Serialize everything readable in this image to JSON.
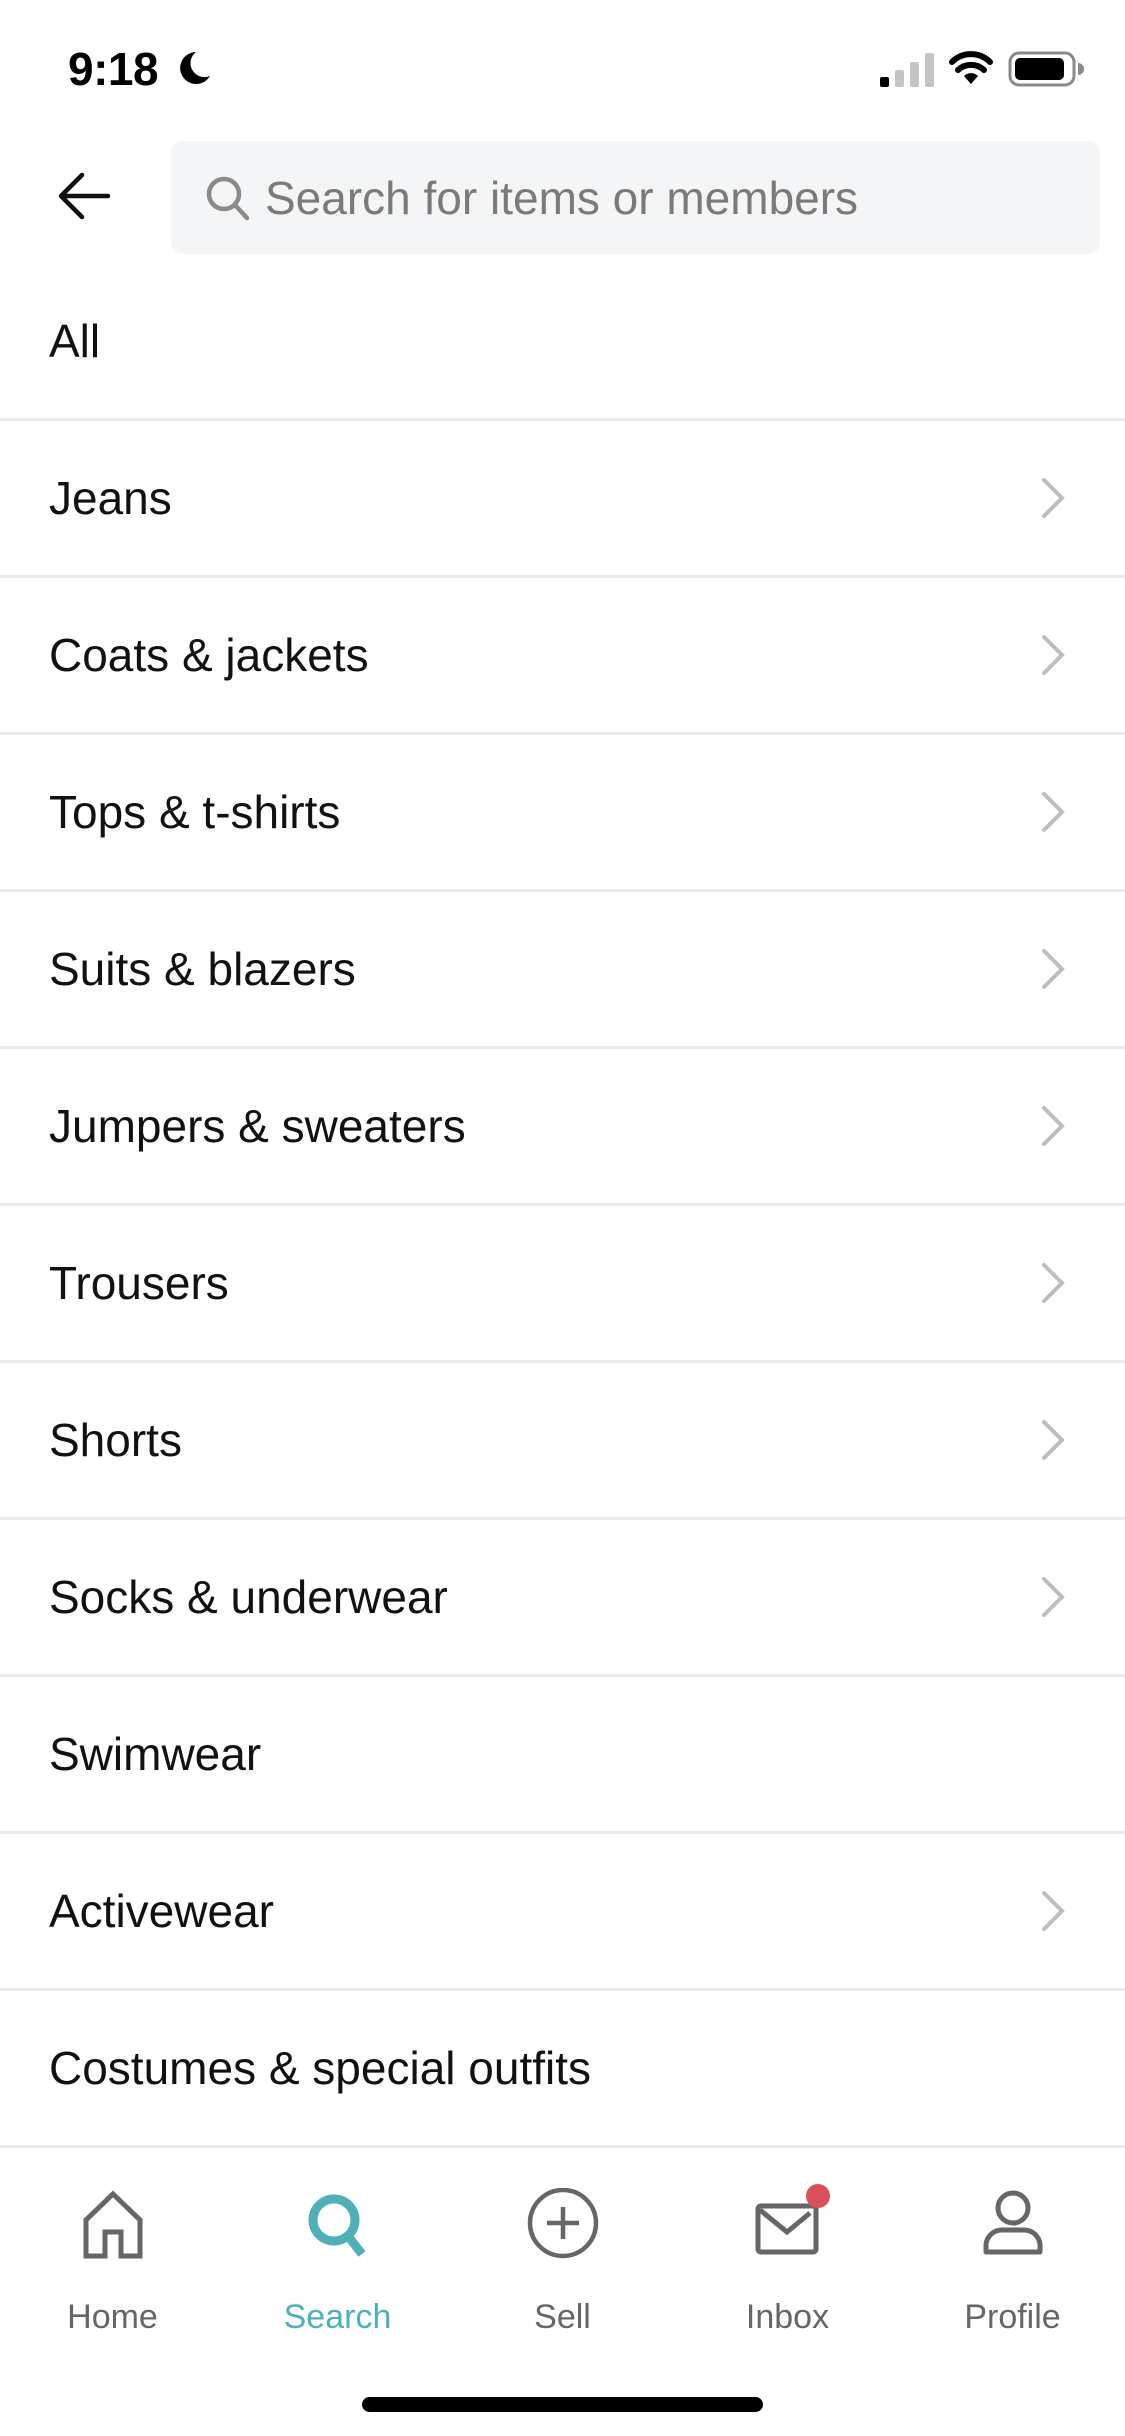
{
  "status_bar": {
    "time": "9:18",
    "focus_icon": "moon-icon",
    "signal_bars_active": 1,
    "signal_bars_total": 4,
    "wifi_icon": "wifi-icon",
    "battery_level_percent": 85
  },
  "header": {
    "back_icon": "arrow-left-icon",
    "search": {
      "placeholder": "Search for items or members",
      "value": "",
      "icon": "search-icon"
    }
  },
  "categories": [
    {
      "label": "All",
      "has_chevron": false
    },
    {
      "label": "Jeans",
      "has_chevron": true
    },
    {
      "label": "Coats & jackets",
      "has_chevron": true
    },
    {
      "label": "Tops & t-shirts",
      "has_chevron": true
    },
    {
      "label": "Suits & blazers",
      "has_chevron": true
    },
    {
      "label": "Jumpers & sweaters",
      "has_chevron": true
    },
    {
      "label": "Trousers",
      "has_chevron": true
    },
    {
      "label": "Shorts",
      "has_chevron": true
    },
    {
      "label": "Socks & underwear",
      "has_chevron": true
    },
    {
      "label": "Swimwear",
      "has_chevron": false
    },
    {
      "label": "Activewear",
      "has_chevron": true
    },
    {
      "label": "Costumes & special outfits",
      "has_chevron": false
    }
  ],
  "tab_bar": {
    "active": "search",
    "tabs": [
      {
        "id": "home",
        "label": "Home",
        "icon": "home-icon"
      },
      {
        "id": "search",
        "label": "Search",
        "icon": "search-icon"
      },
      {
        "id": "sell",
        "label": "Sell",
        "icon": "plus-circle-icon"
      },
      {
        "id": "inbox",
        "label": "Inbox",
        "icon": "envelope-icon",
        "has_notification_badge": true
      },
      {
        "id": "profile",
        "label": "Profile",
        "icon": "user-icon"
      }
    ]
  },
  "colors": {
    "accent": "#4fb0b8",
    "badge": "#d9505a",
    "icon_inactive": "#666666",
    "chevron": "#bdbdbd",
    "divider": "#ebebeb",
    "search_bg": "#f4f5f6"
  }
}
